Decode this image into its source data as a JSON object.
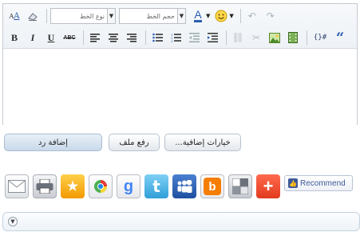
{
  "editor": {
    "font_name_placeholder": "نوع الخط",
    "font_size_placeholder": "حجم الخط",
    "toolbar": {
      "row1_icons": [
        "clear-format-icon",
        "eraser-icon",
        "font-color-icon",
        "smiley-icon",
        "undo-icon",
        "redo-icon"
      ],
      "row2_icons": [
        "bold",
        "italic",
        "underline",
        "strikethrough",
        "align-left",
        "align-center",
        "align-right",
        "unordered-list",
        "ordered-list",
        "outdent",
        "indent",
        "link",
        "unlink",
        "image",
        "media",
        "code",
        "quote"
      ]
    },
    "labels": {
      "bold": "B",
      "italic": "I",
      "underline": "U",
      "strike": "ABC",
      "font_color": "A",
      "code": "{}#",
      "quote": "“"
    }
  },
  "buttons": {
    "extra_options": "...خيارات إضافية",
    "upload_file": "رفع ملف",
    "add_reply": "إضافة رد"
  },
  "share": {
    "icons": [
      "email-icon",
      "print-icon",
      "favorite-star-icon",
      "google-bookmarks-icon",
      "google-plus-icon",
      "twitter-icon",
      "myspace-icon",
      "blogger-icon",
      "delicious-icon",
      "addthis-plus-icon"
    ],
    "recommend_label": "Recommend"
  },
  "colors": {
    "toolbar_bg": "#eef2f6",
    "button_border": "#b7c3d0",
    "primary_button": "#c9d9ea",
    "twitter": "#3fa9e0",
    "blogger": "#f57d00",
    "facebook": "#3b5998",
    "addthis": "#f04935"
  }
}
